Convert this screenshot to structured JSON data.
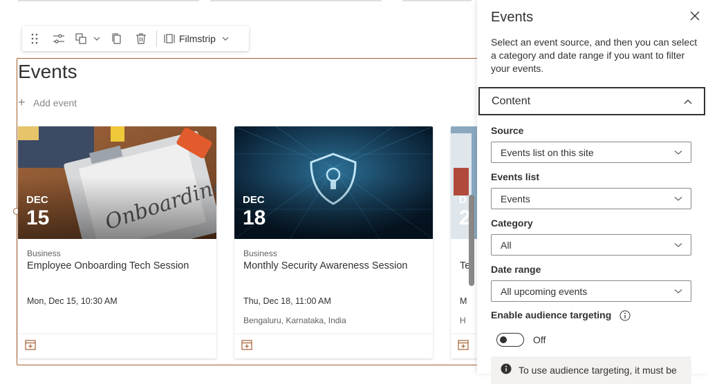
{
  "toolbar": {
    "drag_icon": "drag-handle-icon",
    "settings_icon": "settings-sliders-icon",
    "duplicate_icon": "copy-icon",
    "delete_icon": "trash-icon",
    "layout_icon": "filmstrip-icon",
    "layout_label": "Filmstrip"
  },
  "webpart": {
    "title": "Events",
    "add_event_label": "Add event"
  },
  "events": [
    {
      "month": "DEC",
      "day": "15",
      "category": "Business",
      "title": "Employee Onboarding Tech Session",
      "datetime": "Mon, Dec 15, 10:30 AM",
      "location": ""
    },
    {
      "month": "DEC",
      "day": "18",
      "category": "Business",
      "title": "Monthly Security Awareness Session",
      "datetime": "Thu, Dec 18, 11:00 AM",
      "location": "Bengaluru, Karnataka, India"
    },
    {
      "month": "D",
      "day": "2",
      "category": "",
      "title": "Te",
      "datetime": "M",
      "location": "H"
    }
  ],
  "panel": {
    "title": "Events",
    "description": "Select an event source, and then you can select a category and date range if you want to filter your events.",
    "section_label": "Content",
    "source_label": "Source",
    "source_value": "Events list on this site",
    "list_label": "Events list",
    "list_value": "Events",
    "category_label": "Category",
    "category_value": "All",
    "date_range_label": "Date range",
    "date_range_value": "All upcoming events",
    "targeting_label": "Enable audience targeting",
    "toggle_state": "Off",
    "notice_text": "To use audience targeting, it must be"
  },
  "colors": {
    "accent": "#a25d2e",
    "text": "#323130"
  }
}
